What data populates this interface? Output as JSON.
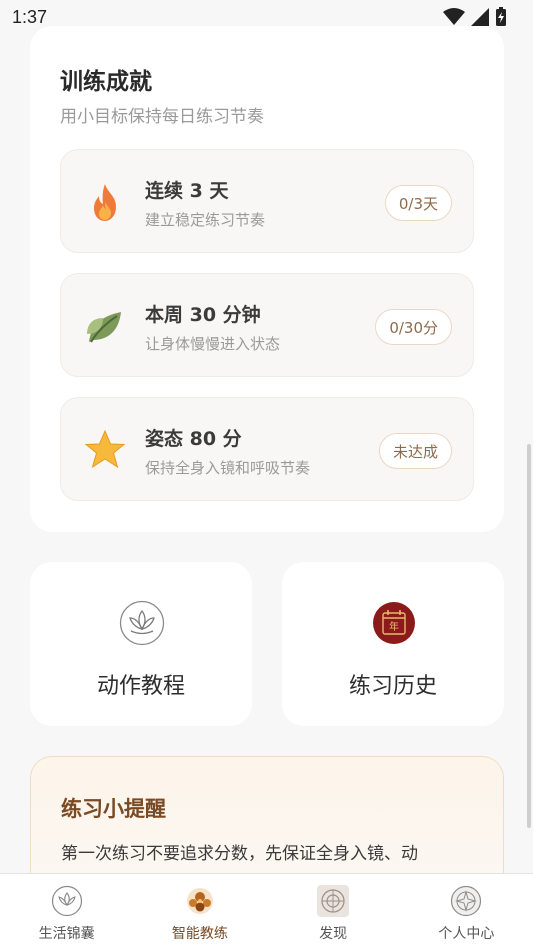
{
  "status_bar": {
    "time": "1:37"
  },
  "achievements": {
    "title": "训练成就",
    "subtitle": "用小目标保持每日练习节奏",
    "items": [
      {
        "name": "连续 3 天",
        "desc": "建立稳定练习节奏",
        "badge": "0/3天",
        "icon": "flame-icon"
      },
      {
        "name": "本周 30 分钟",
        "desc": "让身体慢慢进入状态",
        "badge": "0/30分",
        "icon": "leaf-icon"
      },
      {
        "name": "姿态 80 分",
        "desc": "保持全身入镜和呼吸节奏",
        "badge": "未达成",
        "icon": "star-icon"
      }
    ]
  },
  "tiles": {
    "tutorial": {
      "label": "动作教程",
      "icon": "lotus-icon"
    },
    "history": {
      "label": "练习历史",
      "icon": "calendar-icon",
      "icon_text": "年"
    }
  },
  "tip": {
    "title": "练习小提醒",
    "text": "第一次练习不要追求分数，先保证全身入镜、动"
  },
  "tabbar": {
    "tabs": [
      {
        "label": "生活锦囊",
        "icon": "lotus-circle-icon"
      },
      {
        "label": "智能教练",
        "icon": "coach-icon",
        "active": true
      },
      {
        "label": "发现",
        "icon": "discover-icon"
      },
      {
        "label": "个人中心",
        "icon": "profile-icon"
      }
    ]
  },
  "colors": {
    "accent": "#7a4a22",
    "badge_text": "#8d6b4b",
    "calendar_red": "#8b1a1a"
  }
}
